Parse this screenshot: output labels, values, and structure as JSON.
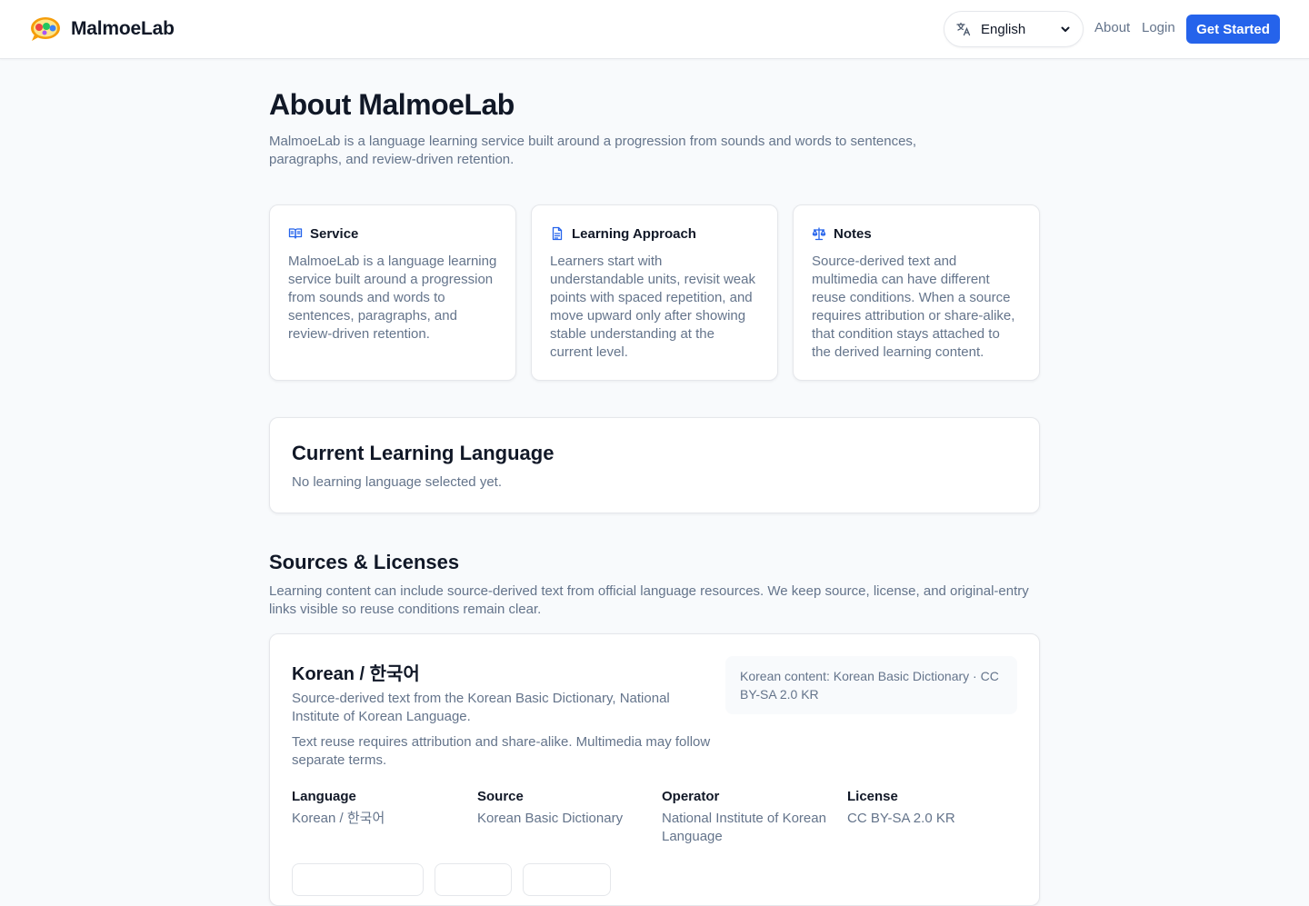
{
  "header": {
    "brand": "MalmoeLab",
    "language_value": "English",
    "nav_about": "About",
    "nav_login": "Login",
    "cta": "Get Started",
    "icons": {
      "language": "translate-icon",
      "dropdown": "chevron-down-icon"
    }
  },
  "page": {
    "title": "About MalmoeLab",
    "intro": "MalmoeLab is a language learning service built around a progression from sounds and words to sentences, paragraphs, and review-driven retention."
  },
  "cards": [
    {
      "icon": "book-open-icon",
      "title": "Service",
      "body": "MalmoeLab is a language learning service built around a progression from sounds and words to sentences, paragraphs, and review-driven retention."
    },
    {
      "icon": "document-icon",
      "title": "Learning Approach",
      "body": "Learners start with understandable units, revisit weak points with spaced repetition, and move upward only after showing stable understanding at the current level."
    },
    {
      "icon": "scale-icon",
      "title": "Notes",
      "body": "Source-derived text and multimedia can have different reuse conditions. When a source requires attribution or share-alike, that condition stays attached to the derived learning content."
    }
  ],
  "current_language": {
    "title": "Current Learning Language",
    "status": "No learning language selected yet."
  },
  "sources": {
    "title": "Sources & Licenses",
    "description": "Learning content can include source-derived text from official language resources. We keep source, license, and original-entry links visible so reuse conditions remain clear.",
    "items": [
      {
        "name": "Korean / 한국어",
        "summary": "Source-derived text from the Korean Basic Dictionary, National Institute of Korean Language.",
        "terms": "Text reuse requires attribution and share-alike. Multimedia may follow separate terms.",
        "badge": "Korean content: Korean Basic Dictionary · CC BY-SA 2.0 KR",
        "meta": [
          {
            "label": "Language",
            "value": "Korean / 한국어"
          },
          {
            "label": "Source",
            "value": "Korean Basic Dictionary"
          },
          {
            "label": "Operator",
            "value": "National Institute of Korean Language"
          },
          {
            "label": "License",
            "value": "CC BY-SA 2.0 KR"
          }
        ]
      }
    ]
  },
  "colors": {
    "accent": "#2563eb",
    "text_primary": "#111827",
    "text_muted": "#64748b",
    "border": "#e5e7eb",
    "page_bg": "#f8fafc"
  }
}
